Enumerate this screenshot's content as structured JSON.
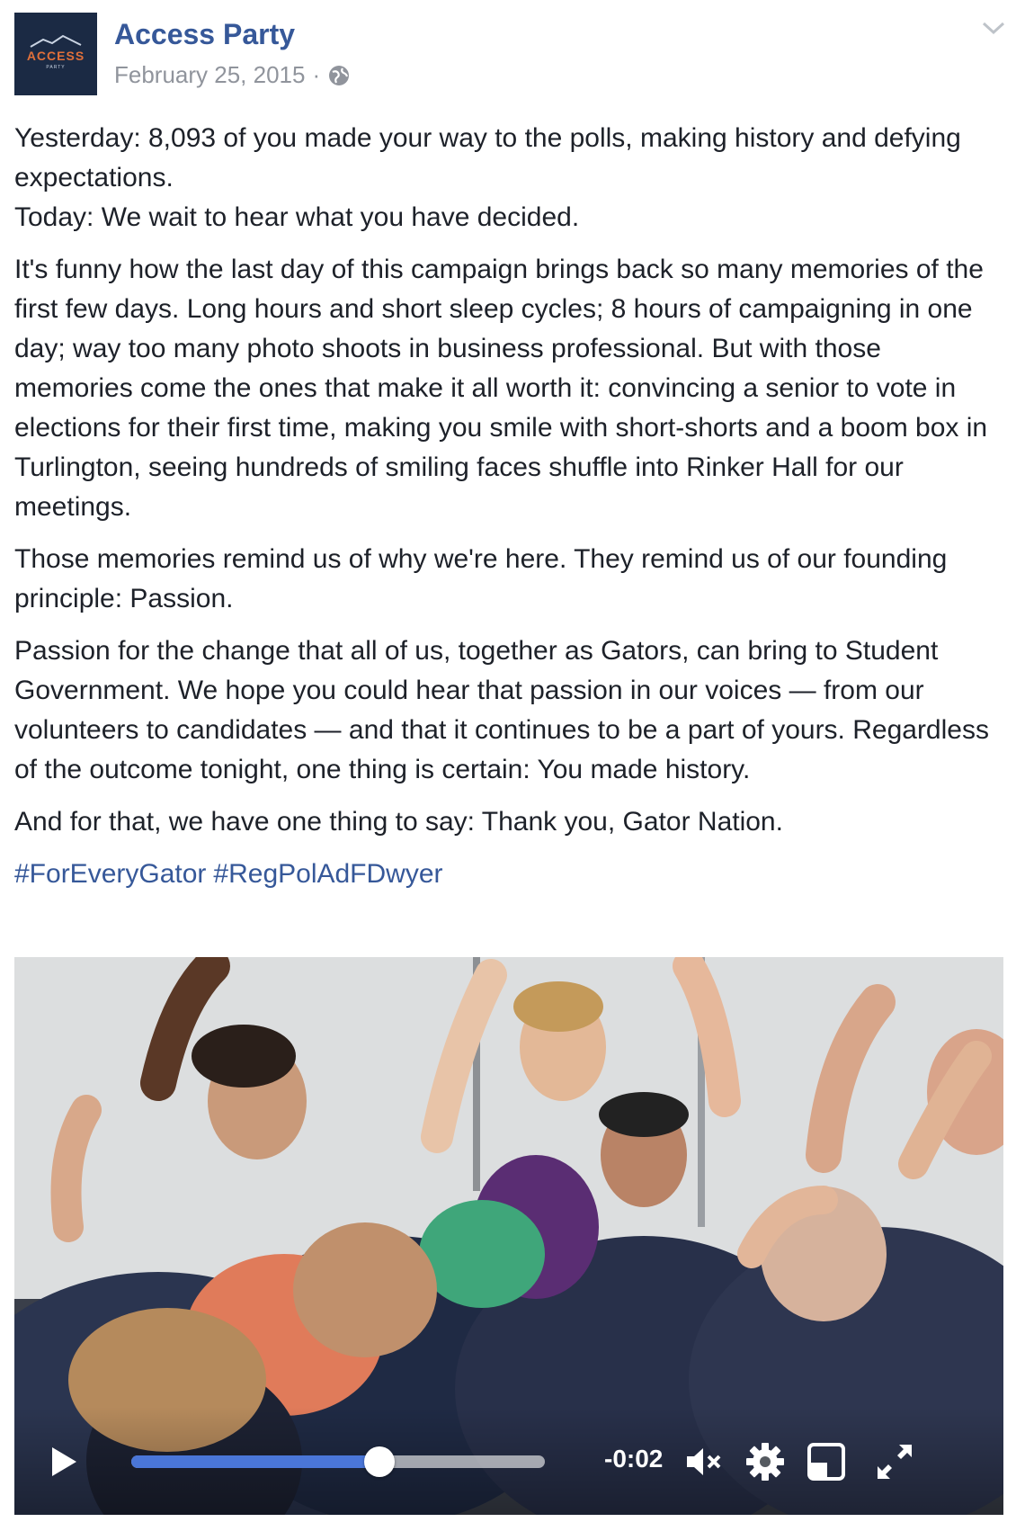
{
  "post": {
    "page_name": "Access Party",
    "date": "February 25, 2015",
    "separator": "·",
    "avatar_logo_text": "ACCESS",
    "avatar_logo_subtext": "PARTY",
    "paragraphs": [
      "Yesterday: 8,093 of you made your way to the polls, making history and defying expectations.\nToday: We wait to hear what you have decided.",
      "It's funny how the last day of this campaign brings back so many memories of the first few days. Long hours and short sleep cycles; 8 hours of campaigning in one day; way too many photo shoots in business professional. But with those memories come the ones that make it all worth it: convincing a senior to vote in elections for their first time, making you smile with short-shorts and a boom box in Turlington, seeing hundreds of smiling faces shuffle into Rinker Hall for our meetings.",
      "Those memories remind us of why we're here. They remind us of our founding principle: Passion.",
      "Passion for the change that all of us, together as Gators, can bring to Student Government. We hope you could hear that passion in our voices — from our volunteers to candidates — and that it continues to be a part of yours. Regardless of the outcome tonight, one thing is certain: You made history.",
      "And for that, we have one thing to say: Thank you, Gator Nation."
    ],
    "hashtags": [
      "#ForEveryGator",
      "#RegPolAdFDwyer"
    ]
  },
  "video": {
    "time_remaining": "-0:02",
    "progress_fraction": 0.6,
    "icons": [
      "play-icon",
      "mute-icon",
      "settings-icon",
      "picture-in-picture-icon",
      "fullscreen-icon"
    ]
  },
  "colors": {
    "link": "#365899",
    "meta": "#90949c",
    "text": "#1d2129",
    "progress": "#4a76d8",
    "avatar_bg": "#1b2a44",
    "avatar_accent": "#e0703a"
  }
}
